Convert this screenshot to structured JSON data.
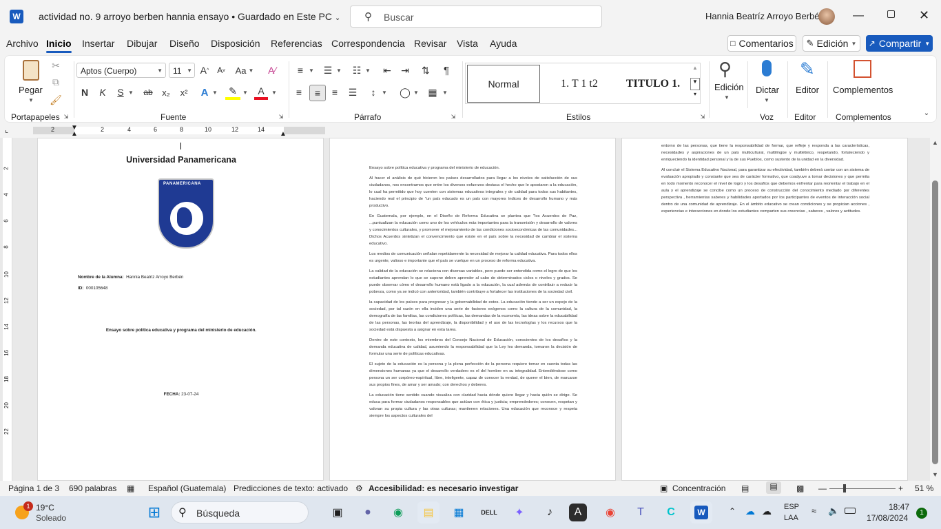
{
  "titlebar": {
    "doc_title": "actividad no. 9 arroyo berben hannia ensayo",
    "save_state": "Guardado en Este PC",
    "search_placeholder": "Buscar",
    "user_name": "Hannia Beatríz Arroyo  Berbén"
  },
  "menu": {
    "items": [
      "Archivo",
      "Inicio",
      "Insertar",
      "Dibujar",
      "Diseño",
      "Disposición",
      "Referencias",
      "Correspondencia",
      "Revisar",
      "Vista",
      "Ayuda"
    ],
    "comments": "Comentarios",
    "edit_mode": "Edición",
    "share": "Compartir"
  },
  "ribbon": {
    "clipboard": {
      "paste": "Pegar",
      "label": "Portapapeles"
    },
    "font": {
      "name": "Aptos (Cuerpo)",
      "size": "11",
      "label": "Fuente",
      "bold": "N",
      "italic": "K",
      "underline": "S",
      "strike": "ab",
      "sub": "x₂",
      "sup": "x²",
      "case": "Aa"
    },
    "paragraph": {
      "label": "Párrafo"
    },
    "styles": {
      "label": "Estilos",
      "items": [
        "Normal",
        "1.  T 1 t2",
        "TITULO 1."
      ]
    },
    "voice": {
      "edit": "Edición",
      "dictate": "Dictar",
      "label": "Voz"
    },
    "editor": {
      "button": "Editor",
      "label": "Editor"
    },
    "addins": {
      "button": "Complementos",
      "label": "Complementos"
    }
  },
  "ruler": {
    "marks": [
      "2",
      "2",
      "4",
      "6",
      "8",
      "10",
      "12",
      "14"
    ]
  },
  "vruler": {
    "marks": [
      "2",
      "4",
      "6",
      "8",
      "10",
      "12",
      "14",
      "16",
      "18",
      "20",
      "22"
    ]
  },
  "page1": {
    "university": "Universidad Panamericana",
    "seal_text": "PANAMERICANA",
    "student_label": "Nombre de la Alumna:",
    "student_name": "Hannia Beatriz Arroyo Berbén",
    "id_label": "ID:",
    "id_value": "000105648",
    "essay_title": "Ensayo sobre política educativa y programa del ministerio de educación.",
    "date_label": "FECHA:",
    "date_value": "23-07-24"
  },
  "page2": {
    "paragraphs": [
      "Ensayo sobre política educativa y programa del ministerio de educación.",
      "Al hacer el análisis de qué hicieron los países desarrollados para llegar a los niveles de satisfacción de sus ciudadanos, nos encontramos que entre los diversos esfuerzos destaca el hecho que le apostaron a la educación, lo cual ha permitido que hoy cuenten con sistemas educativos integrales y de calidad para todos sus habitantes, haciendo real el principio de \"un país educado es un país con mayores índices de desarrollo humano y más productivo.",
      "En Guatemala, por ejemplo, en el Diseño de Reforma Educativa se plantea que \"los Acuerdos de Paz, ...puntualizan la educación como uno de los vehículos más importantes para la transmisión y desarrollo de valores y conocimientos culturales, y promover el mejoramiento de las condiciones socioeconómicas de las comunidades... Dichos Acuerdos sintetizan el convencimiento que existe en el país sobre la necesidad de cambiar el sistema educativo.",
      "Los medios de comunicación señalan repetidamente la necesidad de mejorar la calidad educativa. Para todos ellos es urgente, valioso e importante que el país se vuelque en un proceso de reforma educativa.",
      "La calidad de la educación se relaciona con diversas variables, pero puede ser entendida como el logro de que los estudiantes aprendan lo que se supone deben aprender al cabo de determinados ciclos o niveles y grados. Se puede observar cómo el desarrollo humano está ligado a la educación, la cual además de contribuir a reducir la pobreza, como ya se indicó con anterioridad, también contribuye a fortalecer las instituciones de la sociedad civil.",
      "la capacidad de los países para progresar y la gobernabilidad de estos. La educación tiende a ser un espejo de la sociedad, por tal razón en ella inciden una serie de factores exógenos como la cultura de la comunidad, la demografía de las familias, las condiciones políticas, las demandas de la economía, las ideas sobre la educabilidad de las personas, las teorías del aprendizaje, la disponibilidad y el uso de las tecnologías y los recursos que la sociedad está dispuesta a asignar en esta tarea.",
      "Dentro de este contexto, los miembros del Consejo Nacional de Educación, conscientes de los desafíos y la demanda educativa de calidad, asumiendo la responsabilidad que la Ley les demanda, tomaron la decisión de formular una serie de políticas educativas.",
      "El sujeto de la educación es la persona y la plena perfección de la persona requiere tomar en cuenta todas las dimensiones humanas ya que el desarrollo verdadero es el del hombre en su integralidad. Entendiéndose como persona un ser corpóreo-espiritual, libre, inteligente, capaz de conocer la verdad, de querer el bien, de marcarse sus propios fines, de amar y ser amado; con derechos y deberes.",
      "La educación tiene sentido cuando visualiza con claridad hacia dónde quiere llegar y hacia quién se dirige. Se educa para formar ciudadanos responsables que actúan con ética y justicia; emprendedores; conocen, respetan y valoran su propia cultura y las otras culturas; mantienen relaciones. Una educación que reconoce y respeta siempre los aspectos culturales del"
    ]
  },
  "page3": {
    "paragraphs": [
      "entorno de las personas, que tiene la responsabilidad de formar, que refleje y responda a las características, necesidades y aspiraciones de un país multicultural, multilingüe y multiétnico, respetando, fortaleciendo y enriqueciendo la identidad personal y la de sus Pueblos, como sustento de la unidad en la diversidad.",
      "Al concluir el  Sistema Educativo Nacional, para garantizar su efectividad, también deberá contar con un sistema de evaluación apropiado y constante que sea de carácter formativo, que coadyuve a tomar decisiones y que permita en todo momento reconocer el nivel de logro y los desafíos que debemos enfrentar para reorientar el trabajo en el aula y el aprendizaje se concibe como un proceso de construcción del conocimiento mediado por diferentes perspectiva , herramientas saberes y habilidades aportados por los participantes de eventos de interacción social dentro de una comunidad de aprendizaje. En el ámbito educativo se crean condiciones y se propician acciones , experiencias e interacciones en donde los estudiantes comparten  sus creencias , saberes , valores y actitudes."
    ]
  },
  "statusbar": {
    "page": "Página 1 de 3",
    "words": "690 palabras",
    "language": "Español (Guatemala)",
    "predictions": "Predicciones de texto: activado",
    "accessibility": "Accesibilidad: es necesario investigar",
    "focus": "Concentración",
    "zoom": "51 %"
  },
  "taskbar": {
    "weather_temp": "19°C",
    "weather_desc": "Soleado",
    "weather_badge": "1",
    "search": "Búsqueda",
    "lang": "ESP",
    "lang2": "LAA",
    "time": "18:47",
    "date": "17/08/2024",
    "notif": "1"
  },
  "colors": {
    "accent": "#185abd",
    "word_blue": "#2b579a"
  }
}
